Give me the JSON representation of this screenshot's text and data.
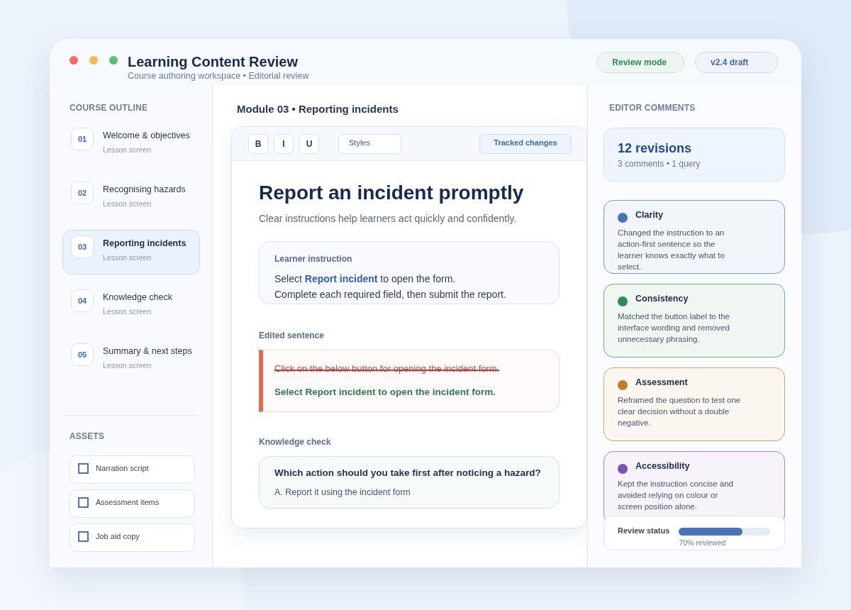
{
  "window": {
    "title": "Learning Content Review",
    "subtitle": "Course authoring workspace • Editorial review",
    "controls": [
      {
        "color": "#fa6b5b"
      },
      {
        "color": "#fbb94b"
      },
      {
        "color": "#5bc36f"
      }
    ],
    "badges": [
      {
        "label": "Review mode",
        "color": "#2e8b57"
      },
      {
        "label": "v2.4 draft",
        "color": "#3f66b0"
      }
    ]
  },
  "sidebar": {
    "outline_heading": "COURSE OUTLINE",
    "lessons": [
      {
        "number": "01",
        "title": "Welcome & objectives",
        "subtitle": "Lesson screen",
        "selected": false
      },
      {
        "number": "02",
        "title": "Recognising hazards",
        "subtitle": "Lesson screen",
        "selected": false
      },
      {
        "number": "03",
        "title": "Reporting incidents",
        "subtitle": "Lesson screen",
        "selected": true
      },
      {
        "number": "04",
        "title": "Knowledge check",
        "subtitle": "Lesson screen",
        "selected": false
      },
      {
        "number": "05",
        "title": "Summary & next steps",
        "subtitle": "Lesson screen",
        "selected": false
      }
    ],
    "assets_heading": "ASSETS",
    "assets": [
      {
        "label": "Narration script",
        "checked": false
      },
      {
        "label": "Assessment items",
        "checked": false
      },
      {
        "label": "Job aid copy",
        "checked": false
      }
    ]
  },
  "editor": {
    "breadcrumb": "Module 03 • Reporting incidents",
    "toolbar": {
      "format_buttons": [
        "B",
        "I",
        "U"
      ],
      "style_dropdown": "Styles",
      "tracked_changes": {
        "label": "Tracked changes",
        "active": true
      }
    },
    "heading": "Report an incident promptly",
    "lead": "Clear instructions help learners act quickly and confidently.",
    "instruction": {
      "label": "Learner instruction",
      "lines": [
        "Select **Report incident** to open the form.",
        "Complete each required field, then submit the report."
      ]
    },
    "edit": {
      "label": "Edited sentence",
      "deleted": "Click on the below button for opening the incident form.",
      "inserted": "Select Report incident to open the incident form."
    },
    "knowledge_check": {
      "label": "Knowledge check",
      "question": "Which action should you take first after noticing a hazard?",
      "options": [
        "A. Report it using the incident form"
      ]
    }
  },
  "comments_panel": {
    "heading": "EDITOR COMMENTS",
    "summary": {
      "title": "12 revisions",
      "detail": "3 comments • 1 query"
    },
    "items": [
      {
        "title": "Clarity",
        "text": "Changed the instruction to an\naction-first sentence so the\nlearner knows exactly what to\nselect.",
        "color": "#4a72b8"
      },
      {
        "title": "Consistency",
        "text": "Matched the button label to the\ninterface wording and removed\nunnecessary phrasing.",
        "color": "#2e8b57"
      },
      {
        "title": "Assessment",
        "text": "Reframed the question to test one\nclear decision without a double\nnegative.",
        "color": "#c27c2a"
      },
      {
        "title": "Accessibility",
        "text": "Kept the instruction concise and\navoided relying on colour or\nscreen position alone.",
        "color": "#7a52b3"
      }
    ],
    "review_status": {
      "label": "Review status",
      "level": 0.7,
      "reading": "70% reviewed"
    }
  }
}
